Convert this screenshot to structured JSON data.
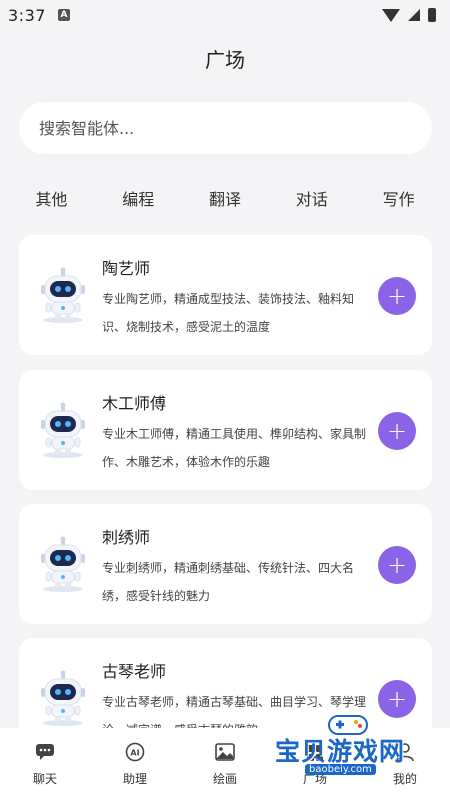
{
  "status_bar": {
    "time": "3:37",
    "notification_letter": "A"
  },
  "header": {
    "title": "广场"
  },
  "search": {
    "placeholder": "搜索智能体..."
  },
  "categories": [
    "其他",
    "编程",
    "翻译",
    "对话",
    "写作"
  ],
  "agents": [
    {
      "name": "陶艺师",
      "description": "专业陶艺师，精通成型技法、装饰技法、釉料知识、烧制技术，感受泥土的温度",
      "action": "+"
    },
    {
      "name": "木工师傅",
      "description": "专业木工师傅，精通工具使用、榫卯结构、家具制作、木雕艺术，体验木作的乐趣",
      "action": "+"
    },
    {
      "name": "刺绣师",
      "description": "专业刺绣师，精通刺绣基础、传统针法、四大名绣，感受针线的魅力",
      "action": "+"
    },
    {
      "name": "古琴老师",
      "description": "专业古琴老师，精通古琴基础、曲目学习、琴学理论、减字谱，感受古琴的雅韵",
      "action": "+"
    }
  ],
  "bottom_nav": [
    {
      "label": "聊天",
      "icon": "chat-icon"
    },
    {
      "label": "助理",
      "icon": "ai-assistant-icon"
    },
    {
      "label": "绘画",
      "icon": "image-icon"
    },
    {
      "label": "广场",
      "icon": "square-icon"
    },
    {
      "label": "我的",
      "icon": "profile-icon"
    }
  ],
  "watermark": {
    "text": "宝贝游戏网",
    "url": "baobeiy.com"
  },
  "colors": {
    "accent": "#8a63e6",
    "background": "#f4f4f7",
    "card": "#ffffff"
  }
}
